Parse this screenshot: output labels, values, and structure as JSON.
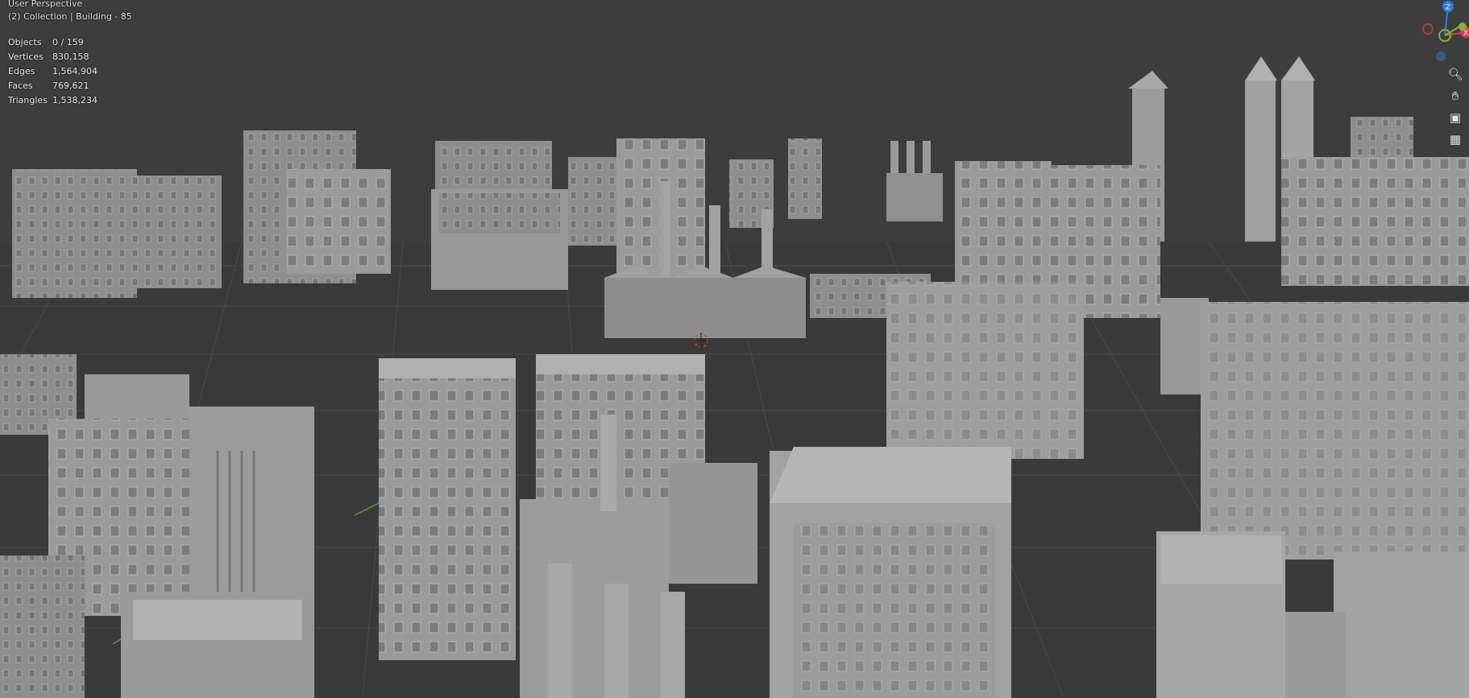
{
  "viewport": {
    "perspective": "User Perspective",
    "collection": "(2) Collection | Building - 85"
  },
  "stats": [
    {
      "label": "Objects",
      "value": "0 / 159"
    },
    {
      "label": "Vertices",
      "value": "830,158"
    },
    {
      "label": "Edges",
      "value": "1,564,904"
    },
    {
      "label": "Faces",
      "value": "769,621"
    },
    {
      "label": "Triangles",
      "value": "1,538,234"
    }
  ],
  "gizmo": {
    "z_label": "Z",
    "x_label": "X",
    "colors": {
      "x": "#e03b4a",
      "y": "#7cb82f",
      "z": "#2f7ce0"
    }
  },
  "nav_icons": [
    "zoom-icon",
    "hand-pan-icon",
    "camera-icon",
    "grid-icon"
  ]
}
